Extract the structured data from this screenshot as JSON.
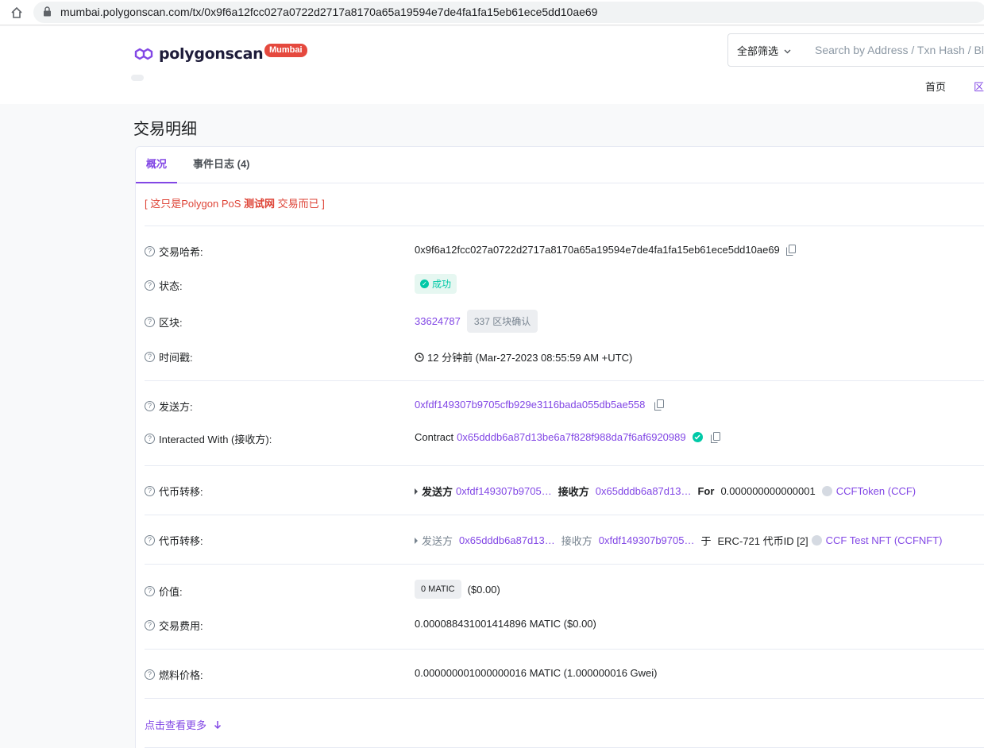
{
  "browser": {
    "url": "mumbai.polygonscan.com/tx/0x9f6a12fcc027a0722d2717a8170a65a19594e7de4fa1fa15eb61ece5dd10ae69"
  },
  "header": {
    "logo_text": "polygonscan",
    "network_badge": "Mumbai",
    "filter_label": "全部筛选",
    "search_placeholder": "Search by Address / Txn Hash / Block / Token",
    "nav": {
      "home": "首页",
      "blockchain": "区"
    }
  },
  "page": {
    "title": "交易明细",
    "tabs": {
      "overview": "概况",
      "logs": "事件日志 (4)"
    },
    "testnet_notice": {
      "open": "[ 这只是Polygon PoS ",
      "bold": "测试网",
      "close": " 交易而已 ]"
    }
  },
  "details": {
    "tx_hash": {
      "label": "交易哈希:",
      "value": "0x9f6a12fcc027a0722d2717a8170a65a19594e7de4fa1fa15eb61ece5dd10ae69"
    },
    "status": {
      "label": "状态:",
      "value": "成功"
    },
    "block": {
      "label": "区块:",
      "number": "33624787",
      "confirmations": "337 区块确认"
    },
    "timestamp": {
      "label": "时间戳:",
      "value": "12 分钟前 (Mar-27-2023 08:55:59 AM +UTC)"
    },
    "from": {
      "label": "发送方:",
      "value": "0xfdf149307b9705cfb929e3116bada055db5ae558"
    },
    "to": {
      "label": "Interacted With (接收方):",
      "prefix": "Contract",
      "value": "0x65dddb6a87d13be6a7f828f988da7f6af6920989"
    },
    "transfer1": {
      "label": "代币转移:",
      "from_label": "发送方",
      "from": "0xfdf149307b9705…",
      "to_label": "接收方",
      "to": "0x65dddb6a87d13…",
      "for_label": "For",
      "amount": "0.000000000000001",
      "token": "CCFToken (CCF)"
    },
    "transfer2": {
      "label": "代币转移:",
      "from_label": "发送方",
      "from": "0x65dddb6a87d13…",
      "to_label": "接收方",
      "to": "0xfdf149307b9705…",
      "at_label": "于",
      "nft_text": "ERC-721 代币ID [2]",
      "token": "CCF Test NFT (CCFNFT)"
    },
    "value": {
      "label": "价值:",
      "badge": "0 MATIC",
      "usd": "($0.00)"
    },
    "fee": {
      "label": "交易费用:",
      "value": "0.000088431001414896 MATIC ($0.00)"
    },
    "gas_price": {
      "label": "燃料价格:",
      "value": "0.000000001000000016 MATIC (1.000000016 Gwei)"
    }
  },
  "more_link": "点击查看更多",
  "colors": {
    "accent": "#8247e5",
    "success": "#00c9a7",
    "danger": "#de4437",
    "badge": "#e5493e"
  }
}
